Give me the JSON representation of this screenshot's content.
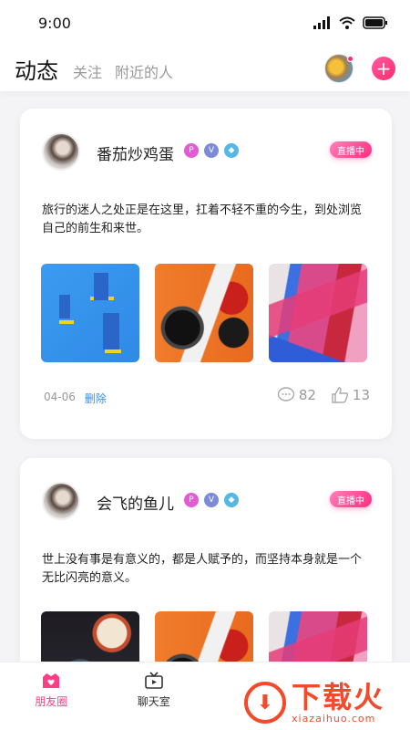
{
  "status_bar": {
    "time": "9:00"
  },
  "header": {
    "active_tab": "动态",
    "tabs": [
      "关注",
      "附近的人"
    ],
    "add_icon": "plus-icon"
  },
  "posts": [
    {
      "user": "番茄炒鸡蛋",
      "live_label": "直播中",
      "text": "旅行的迷人之处正是在这里，扛着不轻不重的今生，到处浏览自己的前生和来世。",
      "date": "04-06",
      "delete_label": "删除",
      "comments": "82",
      "likes": "13",
      "badges": [
        "P",
        "V",
        "◆"
      ]
    },
    {
      "user": "会飞的鱼儿",
      "live_label": "直播中",
      "text": "世上没有事是有意义的，都是人赋予的，而坚持本身就是一个无比闪亮的意义。",
      "badges": [
        "P",
        "V",
        "◆"
      ]
    }
  ],
  "tabbar": {
    "items": [
      {
        "label": "朋友圈",
        "active": true
      },
      {
        "label": "聊天室",
        "active": false
      }
    ]
  },
  "watermark": {
    "title": "下载火",
    "sub": "xiazaihuo.com"
  },
  "colors": {
    "accent": "#ff3d86",
    "link": "#3d8ee8",
    "watermark": "#f24a2a"
  }
}
